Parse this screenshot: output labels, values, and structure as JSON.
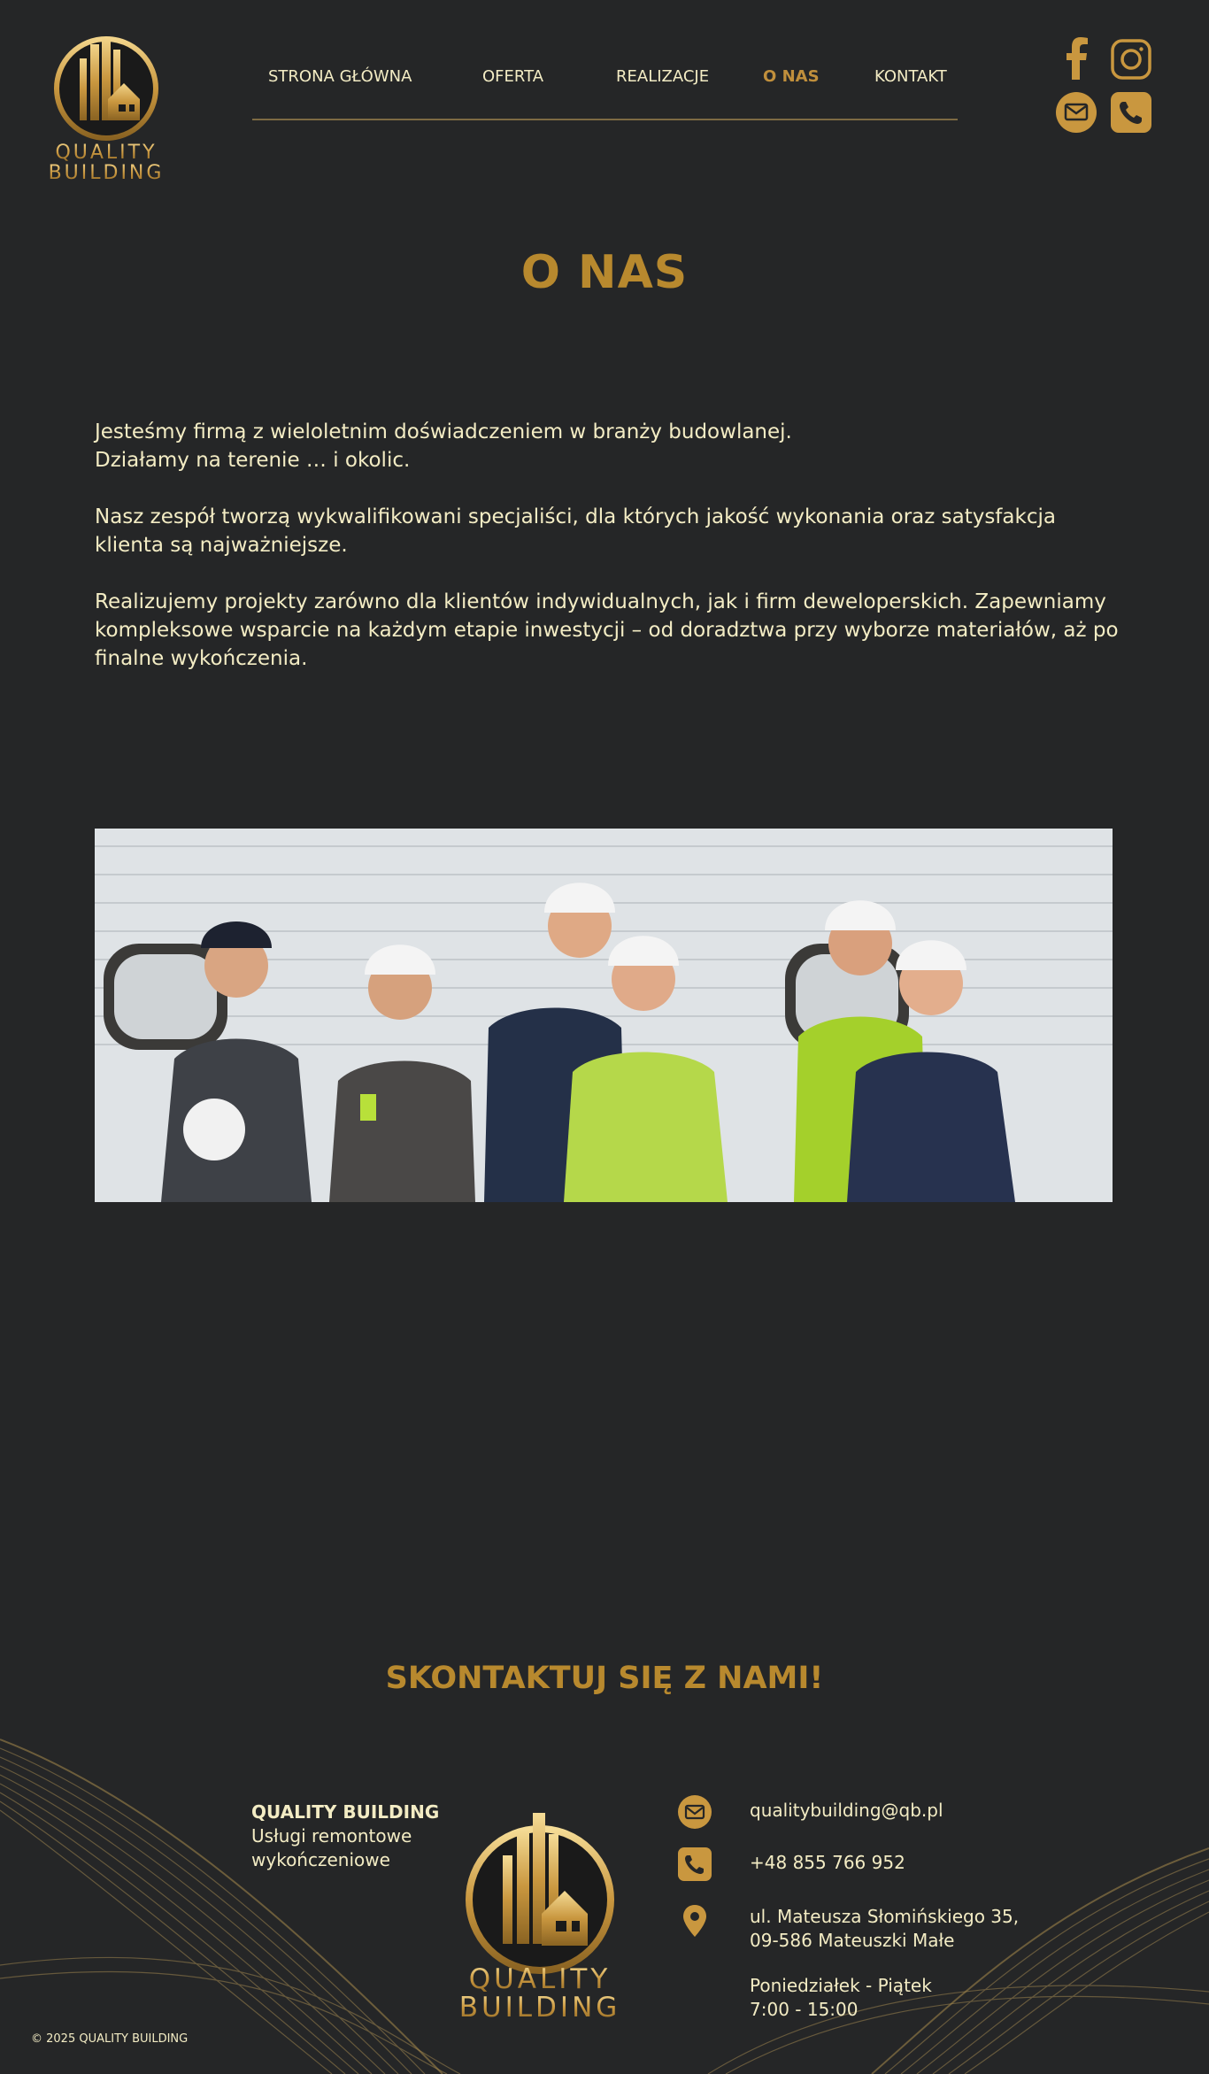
{
  "brand": {
    "logo_line1": "QUALITY",
    "logo_line2": "BUILDING"
  },
  "nav": {
    "items": [
      {
        "label": "STRONA GŁÓWNA"
      },
      {
        "label": "OFERTA"
      },
      {
        "label": "REALIZACJE"
      },
      {
        "label": "O NAS",
        "active": true
      },
      {
        "label": "KONTAKT"
      }
    ]
  },
  "social": {
    "icons": [
      "facebook-icon",
      "instagram-icon",
      "email-icon",
      "phone-icon"
    ]
  },
  "main": {
    "title": "O NAS",
    "paragraphs": [
      "Jesteśmy firmą z wieloletnim doświadczeniem w branży budowlanej.",
      "Działamy na terenie … i okolic.",
      "Nasz zespół tworzą wykwalifikowani specjaliści, dla których jakość wykonania oraz satysfakcja klienta są najważniejsze.",
      "Realizujemy projekty zarówno dla klientów indywidualnych, jak i firm deweloperskich. Zapewniamy kompleksowe wsparcie na każdym etapie inwestycji – od doradztwa przy wyborze materiałów, aż po finalne wykończenia."
    ]
  },
  "contact": {
    "heading": "SKONTAKTUJ SIĘ Z NAMI!",
    "company_name": "QUALITY BUILDING",
    "company_desc1": "Usługi remontowe",
    "company_desc2": "wykończeniowe",
    "email": "qualitybuilding@qb.pl",
    "phone": "+48 855 766 952",
    "address_line1": "ul. Mateusza Słomińskiego 35,",
    "address_line2": "09-586 Mateuszki Małe",
    "hours_days": "Poniedziałek - Piątek",
    "hours_time": "7:00 - 15:00"
  },
  "footer": {
    "copyright": "© 2025 QUALITY BUILDING"
  },
  "colors": {
    "background": "#252627",
    "gold": "#b8892e",
    "text": "#f3ecc4"
  }
}
